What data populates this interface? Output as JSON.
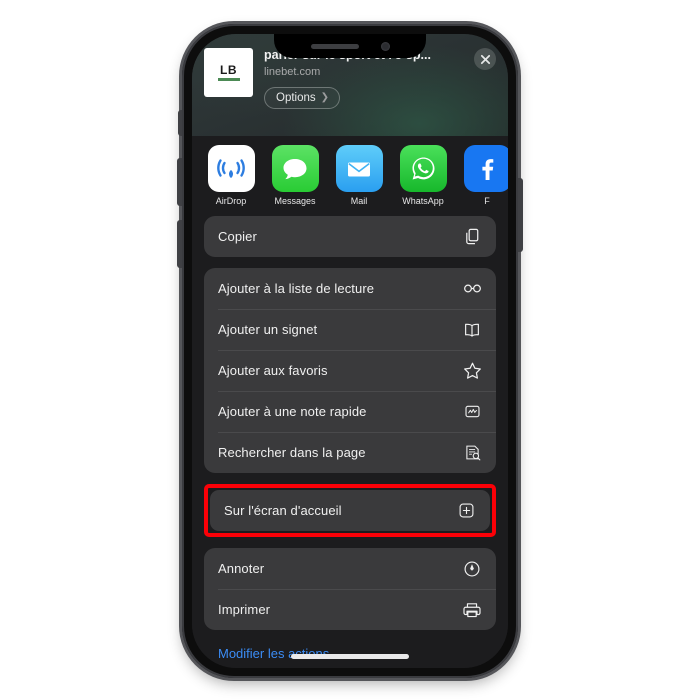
{
  "device": {
    "type": "iphone-mockup",
    "notch": {
      "speaker": "speaker-grille",
      "camera": "front-camera"
    },
    "buttons": [
      "silent-switch",
      "volume-up",
      "volume-down",
      "power-button"
    ],
    "home_indicator": true
  },
  "share_sheet": {
    "favicon": {
      "text": "LB",
      "accent_color": "#4c8a55",
      "background": "#ffffff"
    },
    "title": "parier sur le sport et l'e-sp...",
    "domain": "linebet.com",
    "options_button": {
      "label": "Options",
      "chevron": "chevron-right-icon"
    },
    "close_button": {
      "icon": "close-icon"
    },
    "apps": [
      {
        "name": "AirDrop",
        "label": "AirDrop",
        "icon": "airdrop-icon",
        "color": "#ffffff"
      },
      {
        "name": "Messages",
        "label": "Messages",
        "icon": "messages-icon",
        "color": "#3cd545"
      },
      {
        "name": "Mail",
        "label": "Mail",
        "icon": "mail-icon",
        "color": "#3fb3f4"
      },
      {
        "name": "WhatsApp",
        "label": "WhatsApp",
        "icon": "whatsapp-icon",
        "color": "#2cc63f"
      },
      {
        "name": "Facebook",
        "label": "F",
        "icon": "facebook-icon",
        "color": "#1877f2"
      }
    ],
    "groups": [
      {
        "id": "copy-group",
        "items": [
          {
            "label": "Copier",
            "icon": "copy-icon"
          }
        ]
      },
      {
        "id": "bookmarks-group",
        "items": [
          {
            "label": "Ajouter à la liste de lecture",
            "icon": "glasses-icon"
          },
          {
            "label": "Ajouter un signet",
            "icon": "book-icon"
          },
          {
            "label": "Ajouter aux favoris",
            "icon": "star-icon"
          },
          {
            "label": "Ajouter à une note rapide",
            "icon": "quick-note-icon"
          },
          {
            "label": "Rechercher dans la page",
            "icon": "find-in-page-icon"
          }
        ]
      },
      {
        "id": "home-screen-group",
        "highlighted": true,
        "highlight_color": "#fb0007",
        "items": [
          {
            "label": "Sur l'écran d'accueil",
            "icon": "add-to-home-icon"
          }
        ]
      },
      {
        "id": "markup-group",
        "items": [
          {
            "label": "Annoter",
            "icon": "markup-pen-icon"
          },
          {
            "label": "Imprimer",
            "icon": "printer-icon"
          }
        ]
      }
    ],
    "edit_actions": {
      "label": "Modifier les actions...",
      "color": "#3b8cf5"
    }
  }
}
